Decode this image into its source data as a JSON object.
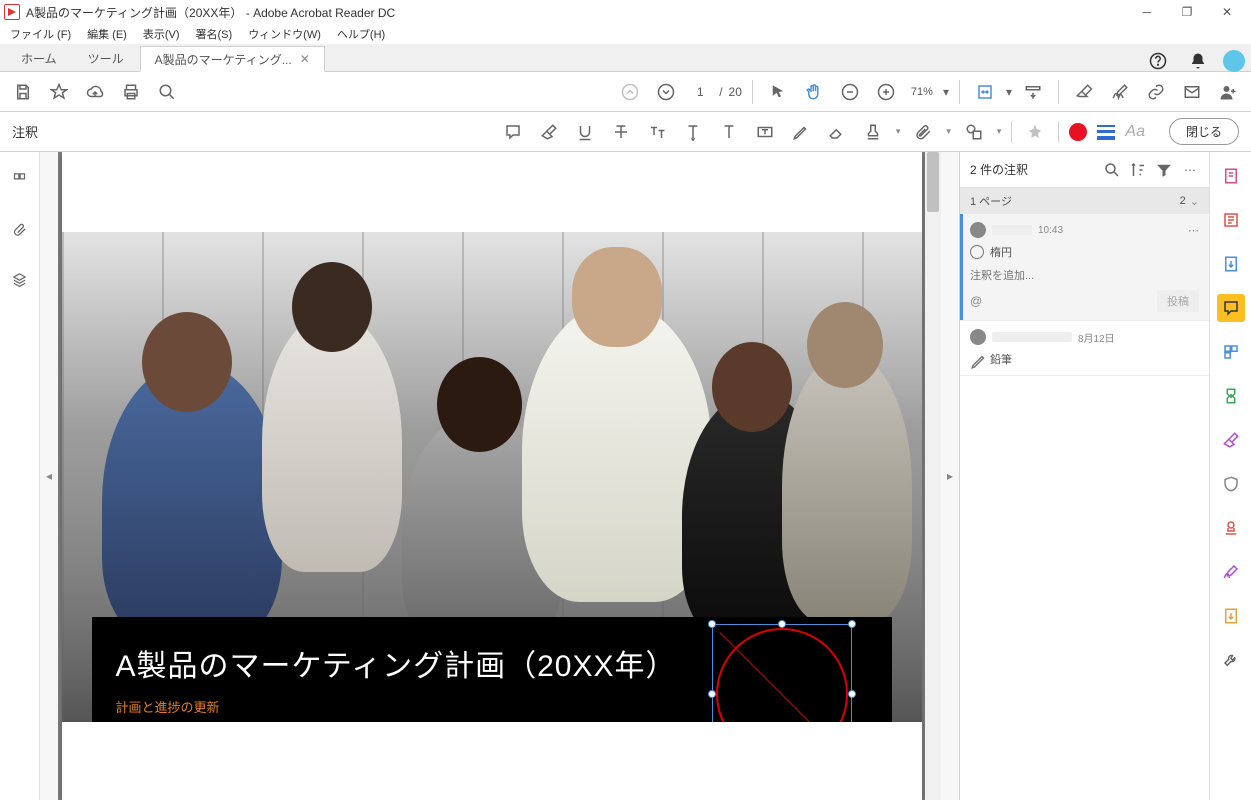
{
  "window": {
    "title": "A製品のマーケティング計画（20XX年）  - Adobe Acrobat Reader DC"
  },
  "menu": {
    "file": "ファイル (F)",
    "edit": "編集 (E)",
    "view": "表示(V)",
    "sign": "署名(S)",
    "window": "ウィンドウ(W)",
    "help": "ヘルプ(H)"
  },
  "tabs": {
    "home": "ホーム",
    "tools": "ツール",
    "doc": "A製品のマーケティング..."
  },
  "toolbar": {
    "page_current": "1",
    "page_sep": "/",
    "page_total": "20",
    "zoom": "71%"
  },
  "comment_bar": {
    "label": "注釈",
    "font_label": "Aa",
    "close": "閉じる"
  },
  "slide": {
    "title": "A製品のマーケティング計画（20XX年）",
    "subtitle": "計画と進捗の更新"
  },
  "comments_panel": {
    "title": "2 件の注釈",
    "page_label": "1 ページ",
    "page_count": "2",
    "items": [
      {
        "time": "10:43",
        "tool": "楕円",
        "add_placeholder": "注釈を追加...",
        "post": "投稿"
      },
      {
        "time": "8月12日",
        "tool": "鉛筆"
      }
    ]
  }
}
